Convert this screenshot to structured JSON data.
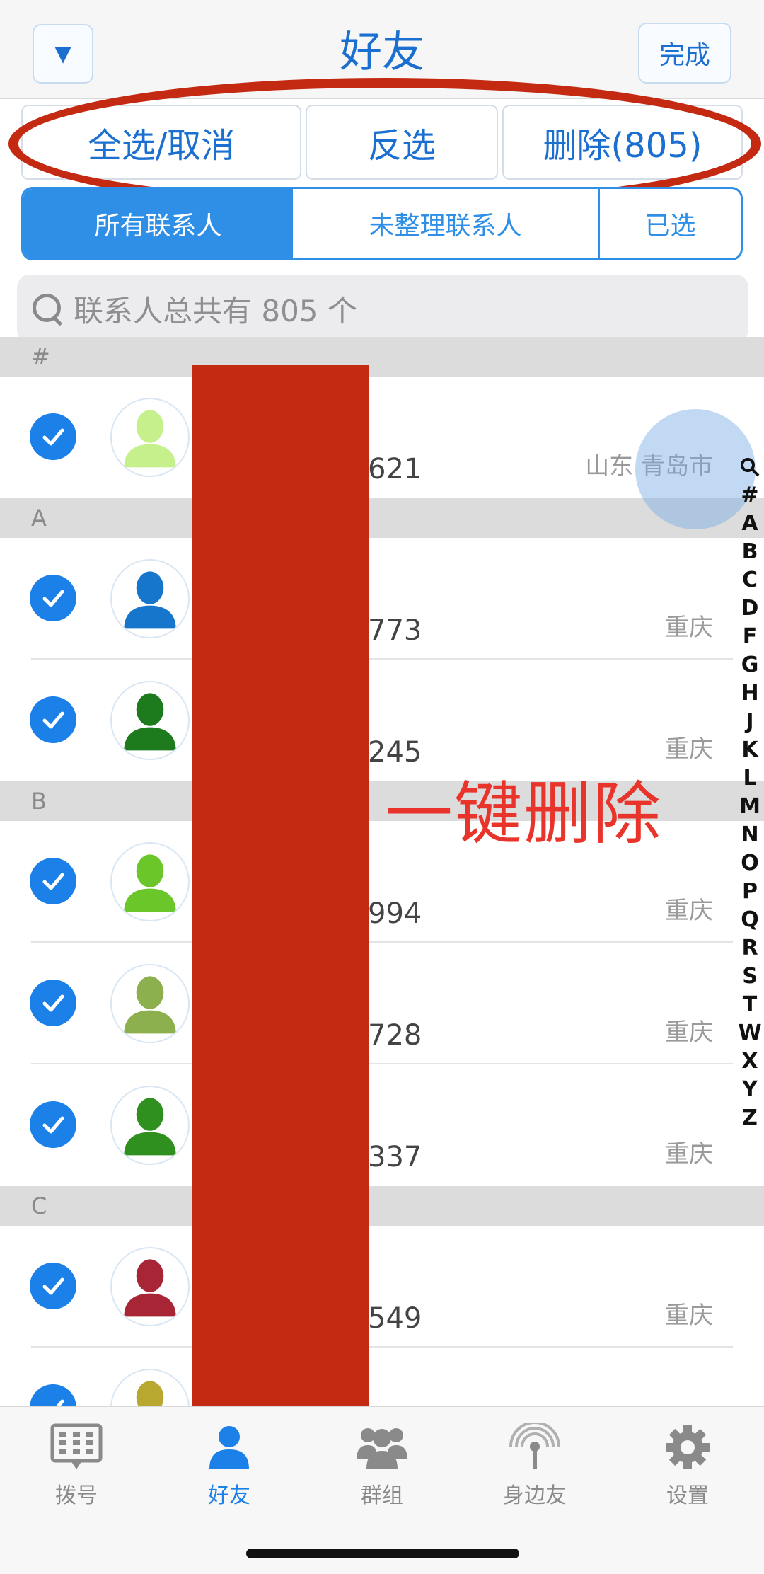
{
  "header": {
    "title": "好友",
    "menu_icon": "▼",
    "done_label": "完成"
  },
  "actions": {
    "select_all": "全选/取消",
    "invert": "反选",
    "delete": "删除(805)"
  },
  "segments": {
    "all": "所有联系人",
    "unsorted": "未整理联系人",
    "selected": "已选"
  },
  "search": {
    "placeholder": "联系人总共有 805 个"
  },
  "overlay_text": "一键删除",
  "sections": [
    {
      "letter": "#",
      "rows": [
        {
          "phone": "621",
          "region": "山东 青岛市",
          "avatar_color": "#c6f08c"
        }
      ]
    },
    {
      "letter": "A",
      "rows": [
        {
          "phone": "773",
          "region": "重庆",
          "avatar_color": "#1576cc"
        },
        {
          "phone": "245",
          "region": "重庆",
          "avatar_color": "#1d7a1d"
        }
      ]
    },
    {
      "letter": "B",
      "rows": [
        {
          "phone": "994",
          "region": "重庆",
          "avatar_color": "#6bc62a"
        },
        {
          "phone": "728",
          "region": "重庆",
          "avatar_color": "#8bb04d"
        },
        {
          "phone": "337",
          "region": "重庆",
          "avatar_color": "#2f8f1f"
        }
      ]
    },
    {
      "letter": "C",
      "rows": [
        {
          "phone": "549",
          "region": "重庆",
          "avatar_color": "#a82535"
        },
        {
          "phone": "",
          "region": "",
          "avatar_color": "#b8a830"
        }
      ]
    }
  ],
  "index_letters": [
    "#",
    "A",
    "B",
    "C",
    "D",
    "F",
    "G",
    "H",
    "J",
    "K",
    "L",
    "M",
    "N",
    "O",
    "P",
    "Q",
    "R",
    "S",
    "T",
    "W",
    "X",
    "Y",
    "Z"
  ],
  "tabs": [
    {
      "label": "拨号",
      "icon": "dialpad-icon",
      "active": false
    },
    {
      "label": "好友",
      "icon": "person-icon",
      "active": true
    },
    {
      "label": "群组",
      "icon": "group-icon",
      "active": false
    },
    {
      "label": "身边友",
      "icon": "signal-tower-icon",
      "active": false
    },
    {
      "label": "设置",
      "icon": "gear-icon",
      "active": false
    }
  ],
  "colors": {
    "accent": "#1b80e8",
    "highlight_red": "#c42a12"
  }
}
